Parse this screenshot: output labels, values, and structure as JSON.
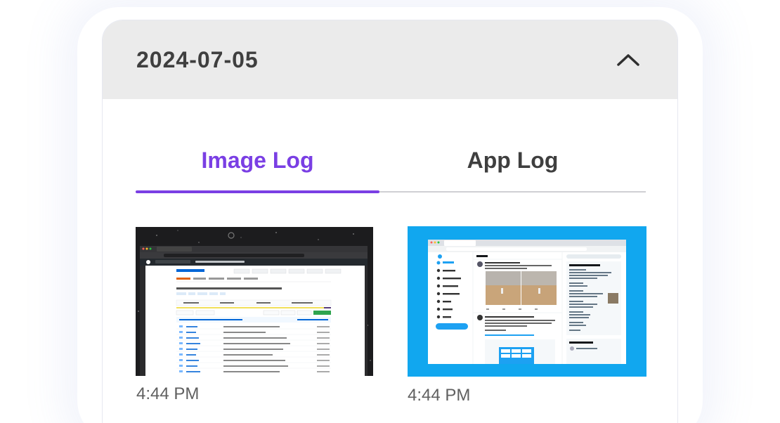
{
  "header": {
    "date": "2024-07-05",
    "collapse_icon": "chevron-up-icon"
  },
  "tabs": [
    {
      "label": "Image Log",
      "active": true
    },
    {
      "label": "App Log",
      "active": false
    }
  ],
  "entries": [
    {
      "time": "4:44 PM",
      "thumbnail": "github-react-repo-screenshot"
    },
    {
      "time": "4:44 PM",
      "thumbnail": "twitter-home-screenshot"
    }
  ],
  "colors": {
    "accent": "#7a3fe4",
    "header_bg": "#ebebeb",
    "text_dark": "#3f3f3f",
    "text_muted": "#606060",
    "twitter_blue": "#11a7ef"
  }
}
